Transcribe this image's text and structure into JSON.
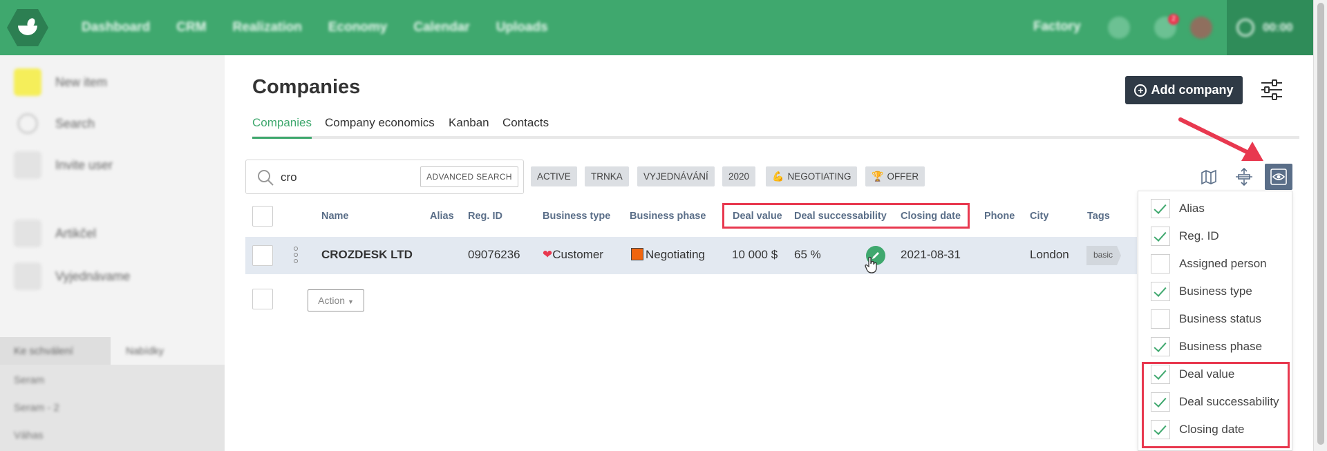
{
  "nav": {
    "items": [
      "Dashboard",
      "CRM",
      "Realization",
      "Economy",
      "Calendar",
      "Uploads"
    ],
    "factory": "Factory",
    "notification_count": "2",
    "timer": "00:00"
  },
  "sidebar": {
    "items": [
      "New item",
      "Search",
      "Invite user",
      "Artikčel",
      "Vyjednávame"
    ],
    "tab_left": "Ke schválení",
    "tab_right": "Nabídky",
    "lower_items": [
      "Seram",
      "Seram - 2",
      "Váhas"
    ]
  },
  "page": {
    "title": "Companies",
    "add_button": "Add company"
  },
  "tabs": [
    "Companies",
    "Company economics",
    "Kanban",
    "Contacts"
  ],
  "search": {
    "value": "cro",
    "advanced_label": "ADVANCED SEARCH"
  },
  "chips": [
    "ACTIVE",
    "TRNKA",
    "VYJEDNÁVÁNÍ",
    "2020",
    "NEGOTIATING",
    "OFFER"
  ],
  "table": {
    "headers": [
      "Name",
      "Alias",
      "Reg. ID",
      "Business type",
      "Business phase",
      "Deal value",
      "Deal successability",
      "Closing date",
      "Phone",
      "City",
      "Tags"
    ],
    "row": {
      "name": "CROZDESK LTD",
      "reg_id": "09076236",
      "business_type": "Customer",
      "business_phase": "Negotiating",
      "deal_value": "10 000 $",
      "deal_successability": "65 %",
      "closing_date": "2021-08-31",
      "city": "London",
      "tag": "basic"
    },
    "action_label": "Action"
  },
  "columns_menu": [
    {
      "label": "Alias",
      "checked": true
    },
    {
      "label": "Reg. ID",
      "checked": true
    },
    {
      "label": "Assigned person",
      "checked": false
    },
    {
      "label": "Business type",
      "checked": true
    },
    {
      "label": "Business status",
      "checked": false
    },
    {
      "label": "Business phase",
      "checked": true
    },
    {
      "label": "Deal value",
      "checked": true
    },
    {
      "label": "Deal successability",
      "checked": true
    },
    {
      "label": "Closing date",
      "checked": true
    }
  ],
  "colors": {
    "brand_green": "#3fa86e",
    "dark_button": "#2f3a46",
    "highlight_red": "#e8384f",
    "header_blue": "#5a6e88"
  }
}
